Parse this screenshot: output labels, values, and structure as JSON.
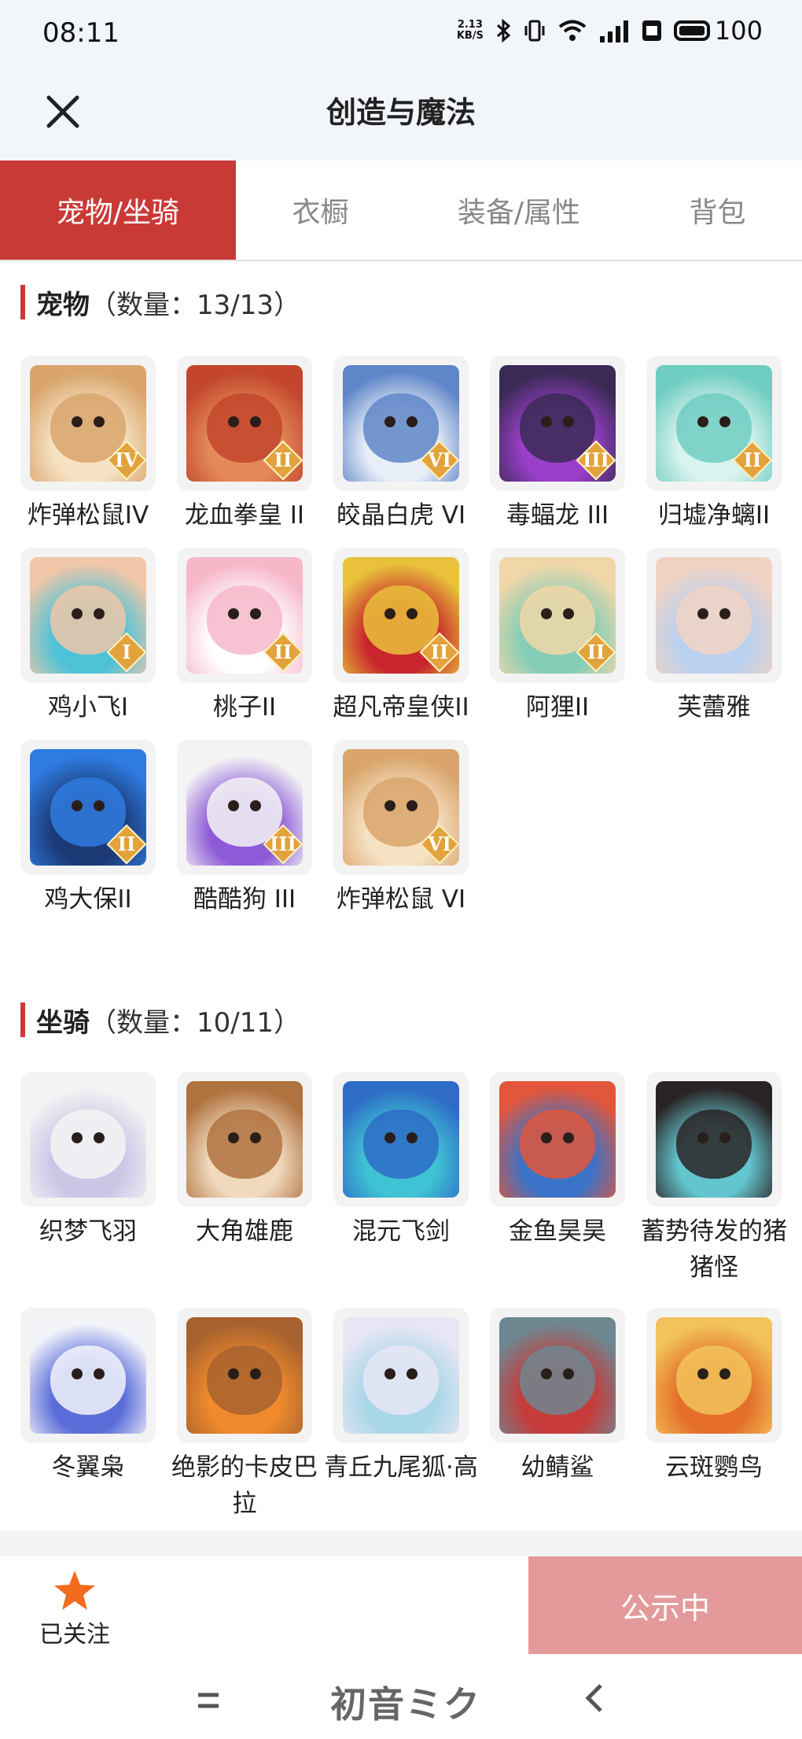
{
  "status": {
    "time": "08:11",
    "net_speed_top": "2.13",
    "net_speed_bottom": "KB/S",
    "battery": "100"
  },
  "header": {
    "title": "创造与魔法"
  },
  "tabs": [
    {
      "label": "宠物/坐骑",
      "active": true
    },
    {
      "label": "衣橱",
      "active": false
    },
    {
      "label": "装备/属性",
      "active": false
    },
    {
      "label": "背包",
      "active": false
    }
  ],
  "pets": {
    "title": "宠物",
    "count": "（数量：13/13）",
    "items": [
      {
        "name": "炸弹松鼠IV",
        "rank": "IV",
        "palette": [
          "#d9a56c",
          "#f6e1c2"
        ]
      },
      {
        "name": "龙血拳皇 II",
        "rank": "II",
        "palette": [
          "#c2452c",
          "#e48a5a"
        ]
      },
      {
        "name": "皎晶白虎 VI",
        "rank": "VI",
        "palette": [
          "#5f86c8",
          "#e8eef8"
        ]
      },
      {
        "name": "毒蝠龙 III",
        "rank": "III",
        "palette": [
          "#3a2a55",
          "#9a3fc9"
        ]
      },
      {
        "name": "归墟净螭II",
        "rank": "II",
        "palette": [
          "#6fcdc2",
          "#d9f3ee"
        ]
      },
      {
        "name": "鸡小飞I",
        "rank": "I",
        "palette": [
          "#f0c7a8",
          "#4ec3d8"
        ]
      },
      {
        "name": "桃子II",
        "rank": "II",
        "palette": [
          "#f6b7c9",
          "#ffffff"
        ]
      },
      {
        "name": "超凡帝皇侠II",
        "rank": "II",
        "palette": [
          "#e9c13b",
          "#c8262c"
        ]
      },
      {
        "name": "阿狸II",
        "rank": "II",
        "palette": [
          "#f1d7a8",
          "#84cdb6"
        ]
      },
      {
        "name": "芙蕾雅",
        "rank": "",
        "palette": [
          "#f1d3c4",
          "#b9d0ef"
        ]
      },
      {
        "name": "鸡大保II",
        "rank": "II",
        "palette": [
          "#2f7be0",
          "#1b3a75"
        ]
      },
      {
        "name": "酷酷狗 III",
        "rank": "III",
        "palette": [
          "#f4f4f4",
          "#8d5bd8"
        ]
      },
      {
        "name": "炸弹松鼠 VI",
        "rank": "VI",
        "palette": [
          "#d9a56c",
          "#f6e1c2"
        ]
      }
    ]
  },
  "mounts": {
    "title": "坐骑",
    "count": "（数量：10/11）",
    "items": [
      {
        "name": "织梦飞羽",
        "rank": "",
        "palette": [
          "#f4f4f4",
          "#c9c6e6"
        ]
      },
      {
        "name": "大角雄鹿",
        "rank": "",
        "palette": [
          "#b0723f",
          "#f0d9bd"
        ]
      },
      {
        "name": "混元飞剑",
        "rank": "",
        "palette": [
          "#2e6cc6",
          "#3fc3d4"
        ]
      },
      {
        "name": "金鱼昊昊",
        "rank": "",
        "palette": [
          "#e2563b",
          "#3a73c8"
        ]
      },
      {
        "name": "蓄势待发的猪猪怪",
        "rank": "",
        "palette": [
          "#2a2324",
          "#63c6cf"
        ]
      },
      {
        "name": "冬翼枭",
        "rank": "",
        "palette": [
          "#f3f4fa",
          "#5a6cd8"
        ]
      },
      {
        "name": "绝影的卡皮巴拉",
        "rank": "",
        "palette": [
          "#a8622f",
          "#f08a2c"
        ]
      },
      {
        "name": "青丘九尾狐·高",
        "rank": "",
        "palette": [
          "#e8e6f4",
          "#a8d7e8"
        ]
      },
      {
        "name": "幼鲭鲨",
        "rank": "",
        "palette": [
          "#6e8790",
          "#c73b3b"
        ]
      },
      {
        "name": "云斑鹦鸟",
        "rank": "",
        "palette": [
          "#f2c35a",
          "#e46e2a"
        ]
      }
    ]
  },
  "footer": {
    "follow_label": "已关注",
    "publish_label": "公示中"
  },
  "navbar": {
    "logo_text": "初音ミク"
  },
  "colors": {
    "accent": "#c93a37",
    "publish_bg": "#e4999a",
    "star": "#f36b1c"
  }
}
